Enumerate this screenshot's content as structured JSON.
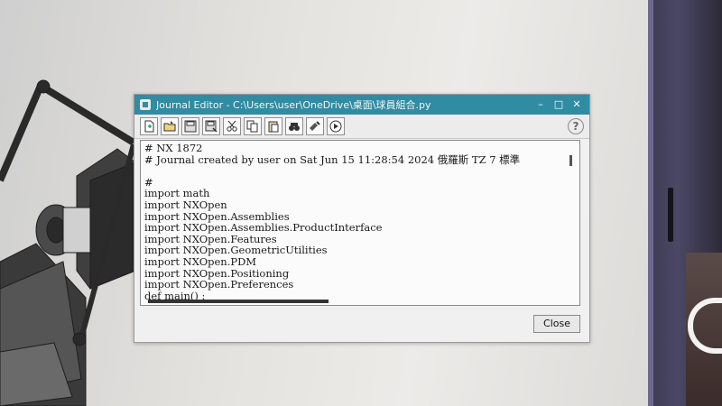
{
  "window": {
    "title": "Journal Editor - C:\\Users\\user\\OneDrive\\桌面\\球員組合.py"
  },
  "titlebar_controls": {
    "minimize": "–",
    "maximize": "□",
    "close": "✕"
  },
  "toolbar": {
    "buttons": [
      {
        "icon": "new-journal-icon"
      },
      {
        "icon": "open-icon"
      },
      {
        "icon": "save-icon"
      },
      {
        "icon": "save-as-icon"
      },
      {
        "icon": "cut-icon"
      },
      {
        "icon": "copy-icon"
      },
      {
        "icon": "paste-icon"
      },
      {
        "icon": "find-icon"
      },
      {
        "icon": "insert-icon"
      },
      {
        "icon": "run-icon"
      }
    ],
    "help_label": "?"
  },
  "editor": {
    "lines": [
      "# NX 1872",
      "# Journal created by user on Sat Jun 15 11:28:54 2024 俄羅斯 TZ 7 標準",
      "",
      "#",
      "import math",
      "import NXOpen",
      "import NXOpen.Assemblies",
      "import NXOpen.Assemblies.ProductInterface",
      "import NXOpen.Features",
      "import NXOpen.GeometricUtilities",
      "import NXOpen.PDM",
      "import NXOpen.Positioning",
      "import NXOpen.Preferences",
      "def main() :"
    ]
  },
  "close_label": "Close"
}
